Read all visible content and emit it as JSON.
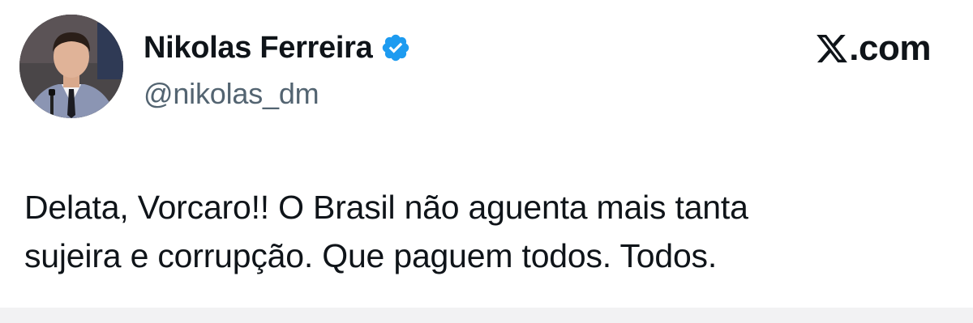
{
  "author": {
    "display_name": "Nikolas Ferreira",
    "handle": "@nikolas_dm",
    "verified": true,
    "avatar_icon": "profile-photo"
  },
  "watermark": {
    "logo_icon": "x-logo-icon",
    "text": ".com"
  },
  "tweet": {
    "lines": [
      "Delata, Vorcaro!! O Brasil não aguenta mais tanta",
      "sujeira e corrupção. Que paguem todos. Todos."
    ]
  },
  "colors": {
    "verified_badge": "#1d9bf0",
    "handle_text": "#536471",
    "primary_text": "#0f1419",
    "background": "#ffffff"
  }
}
